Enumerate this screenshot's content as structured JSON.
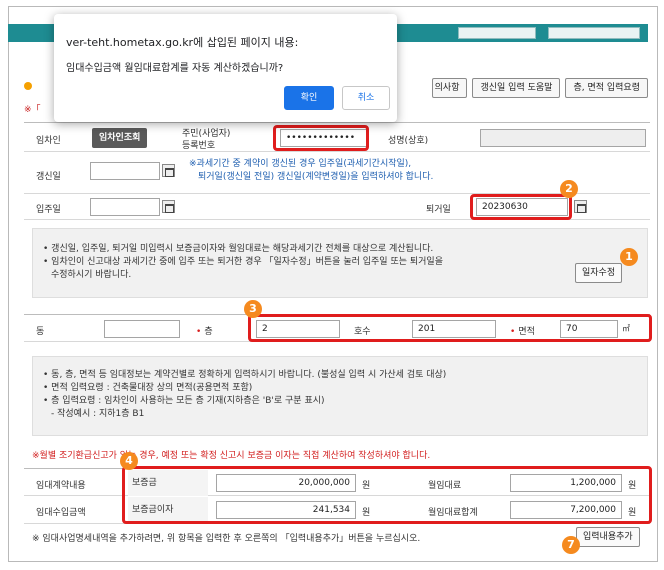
{
  "dialog": {
    "title": "ver-teht.hometax.go.kr에 삽입된 페이지 내용:",
    "message": "임대수입금액 월임대료합계를 자동 계산하겠습니까?",
    "ok_label": "확인",
    "cancel_label": "취소"
  },
  "toolbar": {
    "btn_partial": "의사항",
    "btn_renew_help": "갱신일 입력 도움말",
    "btn_floor_help": "층, 면적 입력요령"
  },
  "notes": {
    "left_partial": "※「",
    "period_note_1": "※과세기간 중 계약이 갱신된 경우 입주일(과세기간시작일),",
    "period_note_2": "퇴거일(갱신일 전일) 갱신일(계약변경일)을 입력하셔야 합니다."
  },
  "tenant": {
    "label": "임차인",
    "lookup_btn": "임차인조회",
    "id_label_1": "주민(사업자)",
    "id_label_2": "등록번호",
    "id_value": "•••••••••••••",
    "name_label": "성명(상호)"
  },
  "dates": {
    "renew_label": "갱신일",
    "movein_label": "입주일",
    "moveout_label": "퇴거일",
    "moveout_value": "20230630"
  },
  "info1": {
    "line1": "• 갱신일, 입주일, 퇴거일 미입력시 보증금이자와 월임대료는 해당과세기간 전체를 대상으로 계산됩니다.",
    "line2": "• 임차인이 신고대상 과세기간 중에 입주 또는 퇴거한 경우 「일자수정」버튼을 눌러 입주일 또는 퇴거일을",
    "line3": "  수정하시기 바랍니다.",
    "fix_btn": "일자수정"
  },
  "unit_row": {
    "dong_label": "동",
    "floor_label": "층",
    "floor_value": "2",
    "ho_label": "호수",
    "ho_value": "201",
    "area_label": "면적",
    "area_value": "70",
    "area_unit": "㎡"
  },
  "info2": {
    "line1": "• 동, 층, 면적 등 임대정보는 계약건별로 정확하게 입력하시기 바랍니다. (불성실 입력 시 가산세 검토 대상)",
    "line2": "• 면적 입력요령 : 건축물대장 상의 면적(공용면적 포함)",
    "line3": "• 층 입력요령 : 임차인이 사용하는 모든 층 기재(지하층은 'B'로 구분 표시)",
    "line4": "  - 작성예시 : 지하1층 B1"
  },
  "warning": "※월별 조기환급신고가 있는 경우, 예정 또는 확정 신고시 보증금 이자는 직접 계산하여 작성하셔야 합니다.",
  "amounts": {
    "contract_label": "임대계약내용",
    "income_label": "임대수입금액",
    "deposit_label": "보증금",
    "deposit_value": "20,000,000",
    "interest_label": "보증금이자",
    "interest_value": "241,534",
    "monthly_label": "월임대료",
    "monthly_value": "1,200,000",
    "monthly_total_label": "월임대료합계",
    "monthly_total_value": "7,200,000",
    "won": "원"
  },
  "footnote": "※ 임대사업명세내역을 추가하려면, 위 항목을 입력한 후 오른쪽의 「입력내용추가」버튼을 누르십시오.",
  "add_btn": "입력내용추가",
  "badges": {
    "b1": "1",
    "b2": "2",
    "b3": "3",
    "b4": "4",
    "b7": "7"
  },
  "colors": {
    "teal": "#1e8c92",
    "highlight_red": "#e01d1d",
    "badge_orange": "#f58a1f",
    "dialog_blue": "#1a73e8"
  }
}
